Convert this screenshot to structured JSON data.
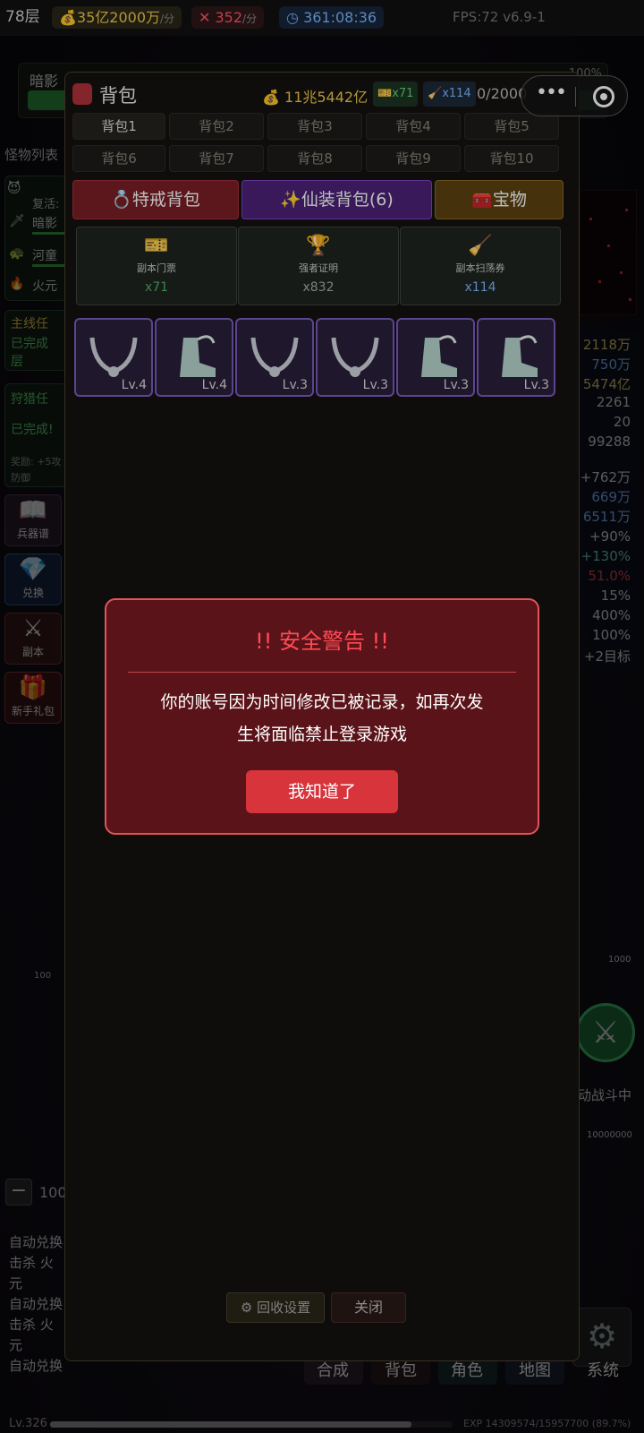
{
  "topbar": {
    "floor": "78层",
    "gold_rate": "35亿2000万",
    "gold_unit": "/分",
    "kill_rate": "352",
    "kill_unit": "/分",
    "timer": "361:08:36",
    "fps": "FPS:72 v6.9-1"
  },
  "left_hud": {
    "boss_title": "暗影",
    "monster_list": "怪物列表",
    "revive": "复活:",
    "monsters": [
      "暗影",
      "河童",
      "火元"
    ],
    "main_quest_title": "主线任",
    "main_quest_status": "已完成",
    "main_quest_extra": "层",
    "hunt_quest_title": "狩猎任",
    "hunt_quest_status": "已完成!",
    "hunt_reward": "奖励: +5攻",
    "hunt_reward2": "防御",
    "buttons": [
      "兵器谱",
      "兑换",
      "副本",
      "新手礼包"
    ],
    "amount": "100",
    "logs": [
      "自动兑换",
      "击杀 火元",
      "自动兑换",
      "击杀 火元",
      "自动兑换"
    ]
  },
  "right_stats": [
    "2118万",
    "750万",
    "5474亿",
    "2261",
    "20",
    "99288",
    "+762万",
    "669万",
    "6511万",
    "+90%",
    "+130%",
    "51.0%",
    "15%",
    "400%",
    "100%",
    "+2目标"
  ],
  "right_extra": {
    "top_pct": "100%",
    "battle_label": "动战斗中",
    "drop_a": "1000",
    "drop_b": "10000000",
    "drop_c": "100"
  },
  "bag": {
    "title": "背包",
    "gold": "11兆5442亿",
    "ticket_count": "x71",
    "broom_count": "x114",
    "capacity": "0/2000",
    "tabs": [
      "背包1",
      "背包2",
      "背包3",
      "背包4",
      "背包5",
      "背包6",
      "背包7",
      "背包8",
      "背包9",
      "背包10"
    ],
    "categories": [
      {
        "label": "特戒背包",
        "icon": "ring-icon",
        "color": "#a3212a"
      },
      {
        "label": "仙装背包(6)",
        "icon": "sparkle-icon",
        "color": "#5b2893"
      },
      {
        "label": "宝物",
        "icon": "treasure-icon",
        "color": "#7a5512"
      }
    ],
    "items": [
      {
        "name": "副本门票",
        "count": "x71",
        "icon": "ticket-icon"
      },
      {
        "name": "强者证明",
        "count": "x832",
        "icon": "trophy-icon"
      },
      {
        "name": "副本扫荡券",
        "count": "x114",
        "icon": "broom-icon"
      }
    ],
    "equipment": [
      {
        "type": "necklace",
        "level": "Lv.4"
      },
      {
        "type": "boots",
        "level": "Lv.4"
      },
      {
        "type": "necklace",
        "level": "Lv.3"
      },
      {
        "type": "necklace",
        "level": "Lv.3"
      },
      {
        "type": "boots",
        "level": "Lv.3"
      },
      {
        "type": "boots",
        "level": "Lv.3"
      }
    ],
    "recycle_label": "回收设置",
    "close_label": "关闭"
  },
  "modal": {
    "title": "!! 安全警告 !!",
    "message_line1": "你的账号因为时间修改已被记录，如再次发",
    "message_line2": "生将面临禁止登录游戏",
    "button": "我知道了"
  },
  "bottom_nav": [
    "合成",
    "背包",
    "角色",
    "地图",
    "系统"
  ],
  "footer": {
    "level": "Lv.326",
    "exp": "EXP 14309574/15957700 (89.7%)",
    "exp_fraction": 0.897
  },
  "colors": {
    "accent_red": "#e2545a",
    "modal_bg": "#5a1318",
    "slot_border": "#7b5bc2",
    "item_green": "#4fb06a"
  }
}
